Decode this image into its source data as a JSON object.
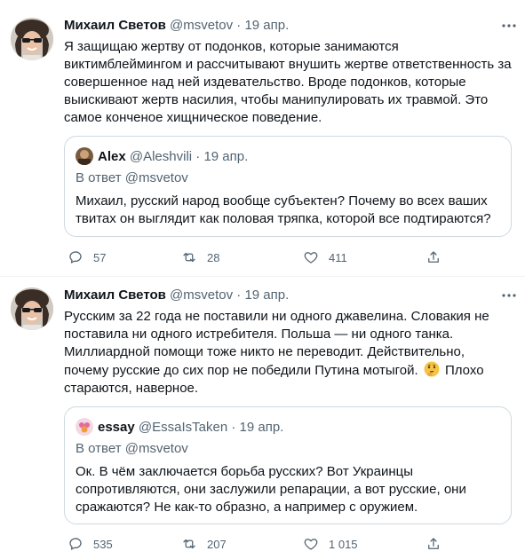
{
  "tweets": [
    {
      "author": "Михаил Светов",
      "handle": "@msvetov",
      "dot": "·",
      "date": "19 апр.",
      "lines": [
        "Я защищаю жертву от подонков, которые занимаются",
        "виктимблеймингом и рассчитывают внушить жертве ответственность за",
        "совершенное над ней издевательство. Вроде подонков, которые",
        "выискивают жертв насилия, чтобы манипулировать их травмой. Это",
        "самое конченое хищническое поведение."
      ],
      "quote": {
        "author": "Alex",
        "handle": "@Aleshvili",
        "dot": "·",
        "date": "19 апр.",
        "reply": "В ответ @msvetov",
        "lines": [
          "Михаил, русский народ вообще субъектен? Почему во всех ваших",
          "твитах он выглядит как половая тряпка, которой все подтираются?"
        ]
      },
      "replies": "57",
      "retweets": "28",
      "likes": "411"
    },
    {
      "author": "Михаил Светов",
      "handle": "@msvetov",
      "dot": "·",
      "date": "19 апр.",
      "lines": [
        "Русским за 22 года не поставили ни одного джавелина. Словакия не",
        "поставила ни одного истребителя. Польша — ни одного танка.",
        "Миллиардной помощи тоже никто не переводит. Действительно,",
        "почему русские до сих пор не победили Путина мотыгой.",
        "стараются, наверное."
      ],
      "line4_after_emoji": "Плохо",
      "quote": {
        "author": "essay",
        "handle": "@EssaIsTaken",
        "dot": "·",
        "date": "19 апр.",
        "reply": "В ответ @msvetov",
        "lines": [
          "Ок. В чём заключается борьба русских? Вот Украинцы",
          "сопротивляются, они заслужили репарации, а вот русские, они",
          "сражаются? Не как-то образно, а например с оружием."
        ]
      },
      "replies": "535",
      "retweets": "207",
      "likes": "1 015"
    }
  ],
  "colors": {
    "text": "#0f1419",
    "secondary": "#536471",
    "border": "#cfd9de",
    "divider": "#eff3f4"
  },
  "icons": [
    "reply-icon",
    "retweet-icon",
    "like-icon",
    "share-icon",
    "more-icon",
    "thinking-face-emoji"
  ]
}
